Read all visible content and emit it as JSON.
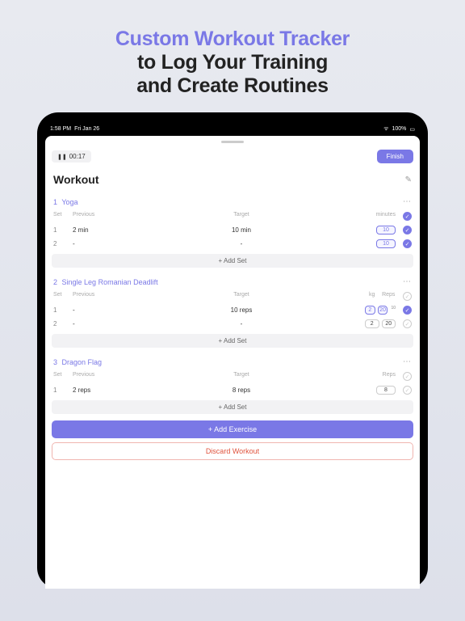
{
  "headline": {
    "line1": "Custom Workout Tracker",
    "line2": "to Log Your Training",
    "line3": "and Create Routines"
  },
  "statusbar": {
    "time": "1:58 PM",
    "date": "Fri Jan 26",
    "wifi": "􀙇",
    "battery_pct": "100%"
  },
  "topbar": {
    "timer": "00:17",
    "finish": "Finish"
  },
  "title": "Workout",
  "labels": {
    "set": "Set",
    "previous": "Previous",
    "target": "Target",
    "minutes": "minutes",
    "kg": "kg",
    "reps": "Reps",
    "add_set": "+  Add Set",
    "add_exercise": "+  Add Exercise",
    "discard": "Discard Workout"
  },
  "exercises": [
    {
      "num": "1",
      "name": "Yoga",
      "unit_cols": [
        "minutes"
      ],
      "sets": [
        {
          "n": "1",
          "prev": "2 min",
          "target": "10 min",
          "vals": [
            "10"
          ],
          "done": true,
          "active": true
        },
        {
          "n": "2",
          "prev": "-",
          "target": "-",
          "vals": [
            "10"
          ],
          "done": true,
          "active": true
        }
      ]
    },
    {
      "num": "2",
      "name": "Single Leg Romanian Deadlift",
      "unit_cols": [
        "kg",
        "Reps"
      ],
      "sets": [
        {
          "n": "1",
          "prev": "-",
          "target": "10 reps",
          "vals": [
            "2",
            "20"
          ],
          "done": true,
          "active": true,
          "sup": "10"
        },
        {
          "n": "2",
          "prev": "-",
          "target": "-",
          "vals": [
            "2",
            "20"
          ],
          "done": false,
          "active": false
        }
      ]
    },
    {
      "num": "3",
      "name": "Dragon Flag",
      "unit_cols": [
        "Reps"
      ],
      "sets": [
        {
          "n": "1",
          "prev": "2 reps",
          "target": "8 reps",
          "vals": [
            "8"
          ],
          "done": false,
          "active": false
        }
      ]
    }
  ]
}
